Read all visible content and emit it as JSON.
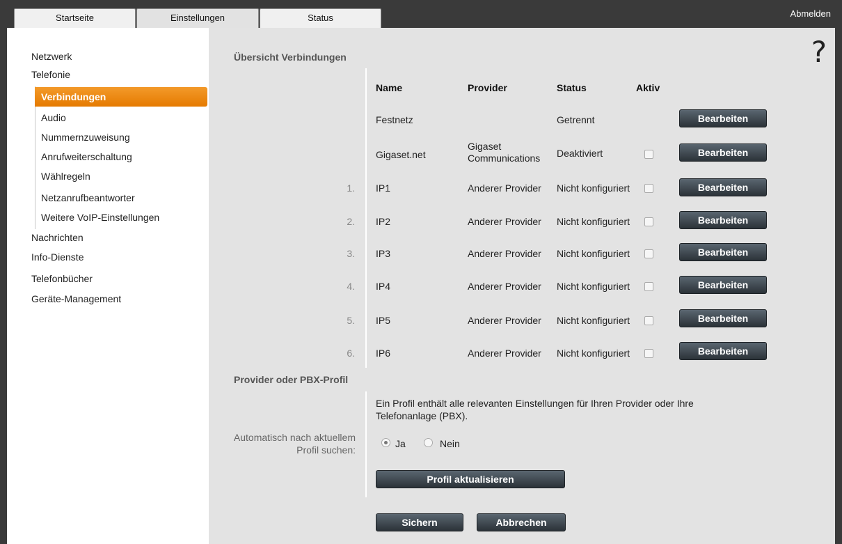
{
  "tabs": [
    {
      "label": "Startseite"
    },
    {
      "label": "Einstellungen"
    },
    {
      "label": "Status"
    }
  ],
  "logout_label": "Abmelden",
  "sidebar": {
    "top": [
      "Netzwerk",
      "Telefonie"
    ],
    "sub": [
      "Verbindungen",
      "Audio",
      "Nummernzuweisung",
      "Anrufweiterschaltung",
      "Wählregeln",
      "Netzanrufbeantworter",
      "Weitere VoIP-Einstellungen"
    ],
    "bottom": [
      "Nachrichten",
      "Info-Dienste",
      "Telefonbücher",
      "Geräte-Management"
    ]
  },
  "help_icon": "?",
  "overview": {
    "title": "Übersicht Verbindungen",
    "headers": {
      "name": "Name",
      "provider": "Provider",
      "status": "Status",
      "active": "Aktiv"
    },
    "rows": [
      {
        "num": "",
        "name": "Festnetz",
        "provider": "",
        "provider2": "",
        "status": "Getrennt",
        "has_checkbox": false,
        "button": "Bearbeiten"
      },
      {
        "num": "",
        "name": "Gigaset.net",
        "provider": "Gigaset",
        "provider2": "Communications",
        "status": "Deaktiviert",
        "has_checkbox": true,
        "button": "Bearbeiten"
      },
      {
        "num": "1.",
        "name": "IP1",
        "provider": "Anderer Provider",
        "provider2": "",
        "status": "Nicht konfiguriert",
        "has_checkbox": true,
        "button": "Bearbeiten"
      },
      {
        "num": "2.",
        "name": "IP2",
        "provider": "Anderer Provider",
        "provider2": "",
        "status": "Nicht konfiguriert",
        "has_checkbox": true,
        "button": "Bearbeiten"
      },
      {
        "num": "3.",
        "name": "IP3",
        "provider": "Anderer Provider",
        "provider2": "",
        "status": "Nicht konfiguriert",
        "has_checkbox": true,
        "button": "Bearbeiten"
      },
      {
        "num": "4.",
        "name": "IP4",
        "provider": "Anderer Provider",
        "provider2": "",
        "status": "Nicht konfiguriert",
        "has_checkbox": true,
        "button": "Bearbeiten"
      },
      {
        "num": "5.",
        "name": "IP5",
        "provider": "Anderer Provider",
        "provider2": "",
        "status": "Nicht konfiguriert",
        "has_checkbox": true,
        "button": "Bearbeiten"
      },
      {
        "num": "6.",
        "name": "IP6",
        "provider": "Anderer Provider",
        "provider2": "",
        "status": "Nicht konfiguriert",
        "has_checkbox": true,
        "button": "Bearbeiten"
      }
    ]
  },
  "profile": {
    "title": "Provider oder PBX-Profil",
    "description_line1": "Ein Profil enthält alle relevanten Einstellungen für Ihren Provider oder Ihre",
    "description_line2": "Telefonanlage (PBX).",
    "auto_label_line1": "Automatisch nach aktuellem",
    "auto_label_line2": "Profil suchen:",
    "yes_label": "Ja",
    "no_label": "Nein",
    "selected": "Ja",
    "update_button": "Profil aktualisieren"
  },
  "footer": {
    "save_button": "Sichern",
    "cancel_button": "Abbrechen"
  }
}
